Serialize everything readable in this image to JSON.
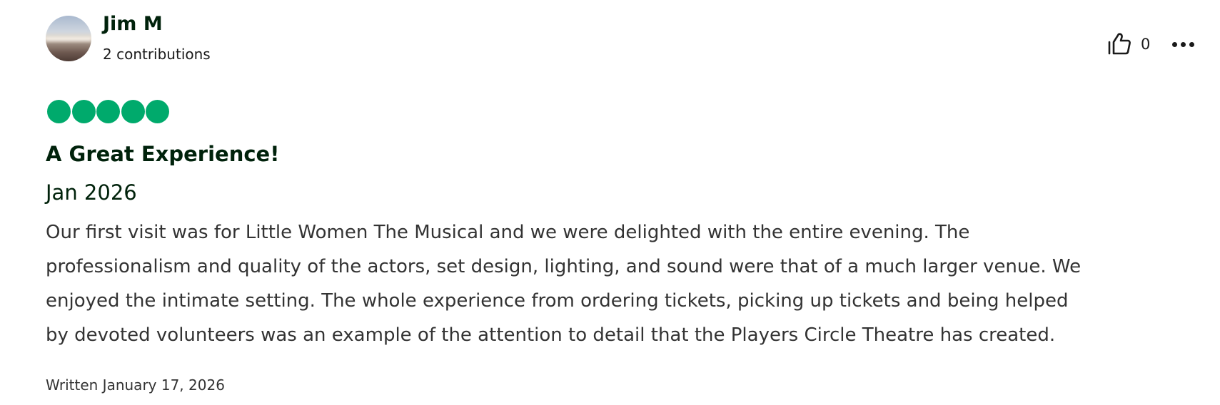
{
  "author": {
    "name": "Jim M",
    "contributions": "2 contributions"
  },
  "actions": {
    "helpful_count": "0",
    "helpful_icon": "thumbs-up-icon",
    "more_icon": "more-options-icon"
  },
  "rating": {
    "value": 5,
    "max": 5,
    "color": "#00aa6c"
  },
  "review": {
    "title": "A Great Experience!",
    "visit_date": "Jan 2026",
    "body_lines": [
      "Our first visit was for Little Women The Musical and we were delighted with the entire evening. The",
      "professionalism and quality of the actors, set design, lighting, and sound were that of a much larger venue. We",
      "enjoyed the intimate setting. The whole experience from ordering tickets, picking up tickets and being helped",
      "by devoted volunteers was an example of the attention to detail that the Players Circle Theatre has created."
    ],
    "written": "Written January 17, 2026"
  }
}
